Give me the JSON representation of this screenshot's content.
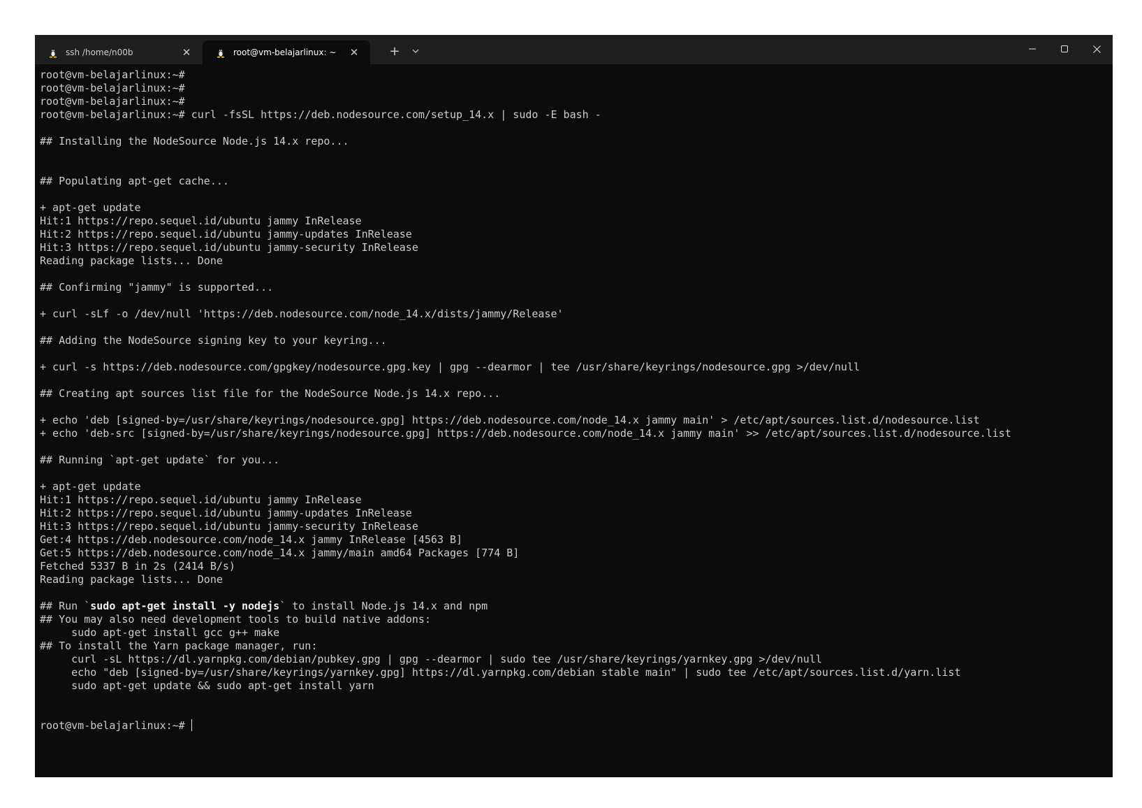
{
  "window": {
    "tabs": [
      {
        "label": "ssh /home/n00b",
        "icon": "linux-tux-icon",
        "active": false
      },
      {
        "label": "root@vm-belajarlinux: ~",
        "icon": "linux-tux-icon",
        "active": true
      }
    ],
    "new_tab_label": "+",
    "controls": [
      "minimize-icon",
      "maximize-icon",
      "close-icon"
    ]
  },
  "terminal": {
    "lines": [
      "root@vm-belajarlinux:~#",
      "root@vm-belajarlinux:~#",
      "root@vm-belajarlinux:~#",
      "root@vm-belajarlinux:~# curl -fsSL https://deb.nodesource.com/setup_14.x | sudo -E bash -",
      "",
      "## Installing the NodeSource Node.js 14.x repo...",
      "",
      "",
      "## Populating apt-get cache...",
      "",
      "+ apt-get update",
      "Hit:1 https://repo.sequel.id/ubuntu jammy InRelease",
      "Hit:2 https://repo.sequel.id/ubuntu jammy-updates InRelease",
      "Hit:3 https://repo.sequel.id/ubuntu jammy-security InRelease",
      "Reading package lists... Done",
      "",
      "## Confirming \"jammy\" is supported...",
      "",
      "+ curl -sLf -o /dev/null 'https://deb.nodesource.com/node_14.x/dists/jammy/Release'",
      "",
      "## Adding the NodeSource signing key to your keyring...",
      "",
      "+ curl -s https://deb.nodesource.com/gpgkey/nodesource.gpg.key | gpg --dearmor | tee /usr/share/keyrings/nodesource.gpg >/dev/null",
      "",
      "## Creating apt sources list file for the NodeSource Node.js 14.x repo...",
      "",
      "+ echo 'deb [signed-by=/usr/share/keyrings/nodesource.gpg] https://deb.nodesource.com/node_14.x jammy main' > /etc/apt/sources.list.d/nodesource.list",
      "+ echo 'deb-src [signed-by=/usr/share/keyrings/nodesource.gpg] https://deb.nodesource.com/node_14.x jammy main' >> /etc/apt/sources.list.d/nodesource.list",
      "",
      "## Running `apt-get update` for you...",
      "",
      "+ apt-get update",
      "Hit:1 https://repo.sequel.id/ubuntu jammy InRelease",
      "Hit:2 https://repo.sequel.id/ubuntu jammy-updates InRelease",
      "Hit:3 https://repo.sequel.id/ubuntu jammy-security InRelease",
      "Get:4 https://deb.nodesource.com/node_14.x jammy InRelease [4563 B]",
      "Get:5 https://deb.nodesource.com/node_14.x jammy/main amd64 Packages [774 B]",
      "Fetched 5337 B in 2s (2414 B/s)",
      "Reading package lists... Done",
      "",
      {
        "segments": [
          {
            "text": "## Run `",
            "bold": false
          },
          {
            "text": "sudo apt-get install -y nodejs",
            "bold": true
          },
          {
            "text": "` to install Node.js 14.x and npm",
            "bold": false
          }
        ]
      },
      "## You may also need development tools to build native addons:",
      "     sudo apt-get install gcc g++ make",
      "## To install the Yarn package manager, run:",
      "     curl -sL https://dl.yarnpkg.com/debian/pubkey.gpg | gpg --dearmor | sudo tee /usr/share/keyrings/yarnkey.gpg >/dev/null",
      "     echo \"deb [signed-by=/usr/share/keyrings/yarnkey.gpg] https://dl.yarnpkg.com/debian stable main\" | sudo tee /etc/apt/sources.list.d/yarn.list",
      "     sudo apt-get update && sudo apt-get install yarn",
      "",
      ""
    ],
    "prompt": "root@vm-belajarlinux:~# "
  },
  "colors": {
    "window_bg": "#0c0c0c",
    "titlebar_bg": "#1f1f1f",
    "text": "#cccccc"
  }
}
